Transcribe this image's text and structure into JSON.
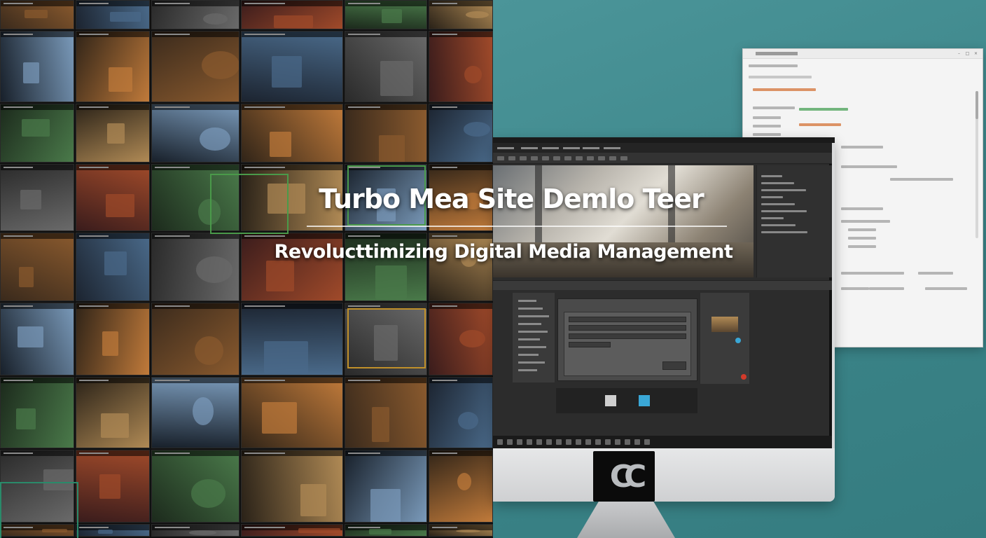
{
  "hero": {
    "title": "Turbo Mea Site Demlo Teer",
    "subtitle": "Revolucttimizing Digital Media Management"
  },
  "monitor": {
    "logo_text": "CC"
  },
  "colors": {
    "background_teal": "#3f8a8e",
    "mosaic_dark": "#101010",
    "panel_light": "#f4f4f4",
    "accent_blue": "#3aa7d6",
    "accent_orange": "#d26a2a",
    "accent_red": "#d23a2a",
    "accent_green": "#3a9a4a"
  },
  "icons": [
    "close-icon",
    "maximize-icon",
    "minimize-icon",
    "back-arrow-icon",
    "checkbox-icon",
    "dropdown-chevron-icon",
    "play-icon",
    "volume-icon"
  ]
}
